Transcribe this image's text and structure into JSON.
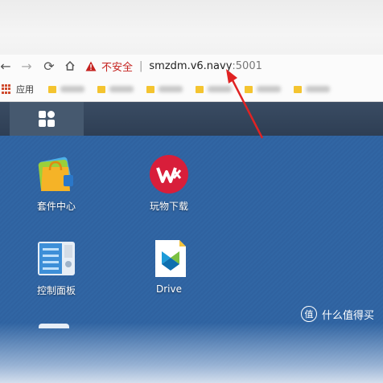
{
  "browser": {
    "insecure_label": "不安全",
    "url_host": "smzdm.v6.navy",
    "url_port": ":5001",
    "apps_label": "应用"
  },
  "desktop": {
    "apps": [
      {
        "label": "套件中心",
        "icon": "package-center-icon"
      },
      {
        "label": "玩物下载",
        "icon": "wanwu-download-icon"
      },
      {
        "label": "控制面板",
        "icon": "control-panel-icon"
      },
      {
        "label": "Drive",
        "icon": "drive-icon"
      }
    ]
  },
  "watermark": {
    "symbol": "值",
    "text": "什么值得买"
  },
  "colors": {
    "insecure": "#c5221f",
    "annotation_arrow": "#e02323",
    "taskbar": "#34465c",
    "desktop": "#2f62a0"
  }
}
